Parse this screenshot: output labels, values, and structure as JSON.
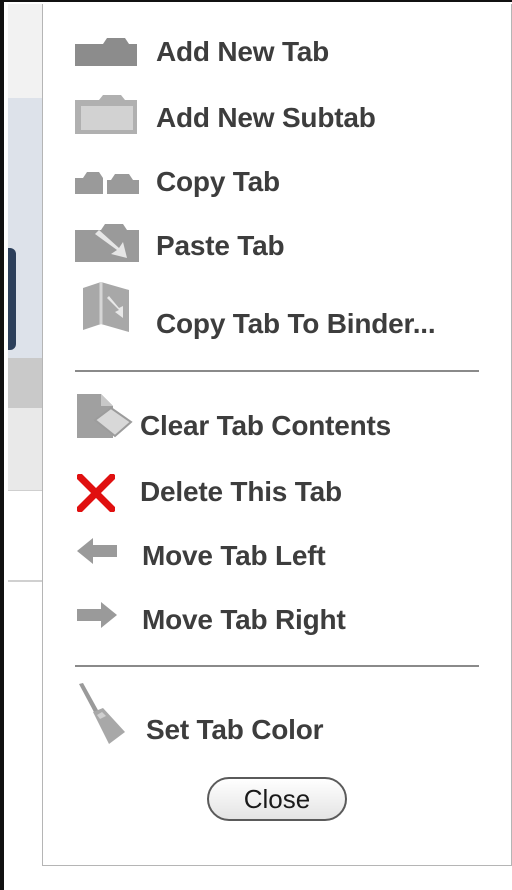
{
  "menu": {
    "items": [
      {
        "label": "Add New Tab",
        "icon": "add-tab-icon"
      },
      {
        "label": "Add New Subtab",
        "icon": "add-subtab-icon"
      },
      {
        "label": "Copy Tab",
        "icon": "copy-tab-icon"
      },
      {
        "label": "Paste Tab",
        "icon": "paste-tab-icon"
      },
      {
        "label": "Copy Tab To Binder...",
        "icon": "binder-icon"
      },
      {
        "label": "Clear Tab Contents",
        "icon": "eraser-icon"
      },
      {
        "label": "Delete This Tab",
        "icon": "red-x-icon"
      },
      {
        "label": "Move Tab Left",
        "icon": "arrow-left-icon"
      },
      {
        "label": "Move Tab Right",
        "icon": "arrow-right-icon"
      },
      {
        "label": "Set Tab Color",
        "icon": "paintbrush-icon"
      }
    ],
    "close_label": "Close"
  },
  "colors": {
    "icon_gray": "#8c8c8c",
    "label_text": "#3d3d3d",
    "delete_red": "#e01010",
    "divider": "#8a8a8a"
  }
}
